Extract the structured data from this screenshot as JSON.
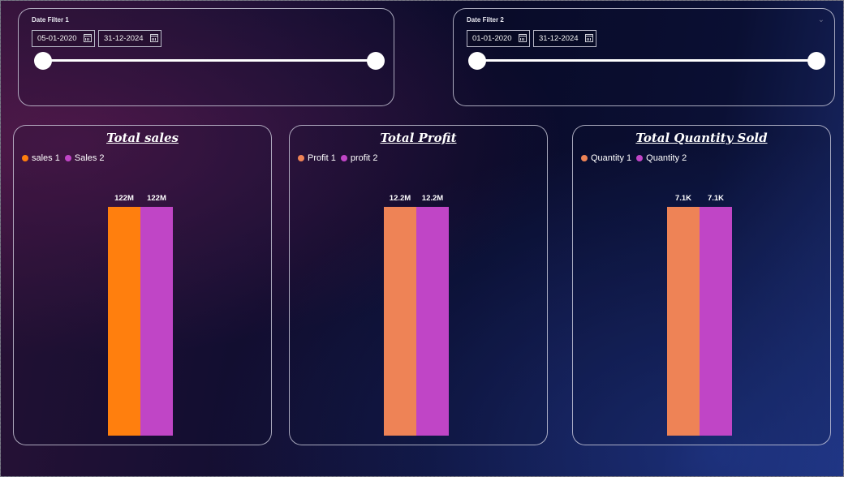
{
  "filters": [
    {
      "title": "Date Filter 1",
      "start": "05-01-2020",
      "end": "31-12-2024"
    },
    {
      "title": "Date Filter 2",
      "start": "01-01-2020",
      "end": "31-12-2024"
    }
  ],
  "chart_data": [
    {
      "type": "bar",
      "title": "Total sales",
      "categories": [
        "sales 1",
        "Sales 2"
      ],
      "series": [
        {
          "name": "sales 1",
          "values": [
            122000000
          ],
          "label": "122M",
          "color": "#FF7F0E"
        },
        {
          "name": "Sales 2",
          "values": [
            122000000
          ],
          "label": "122M",
          "color": "#C045C6"
        }
      ],
      "ylim": [
        0,
        122000000
      ]
    },
    {
      "type": "bar",
      "title": "Total Profit",
      "categories": [
        "Profit 1",
        "profit 2"
      ],
      "series": [
        {
          "name": "Profit 1",
          "values": [
            12200000
          ],
          "label": "12.2M",
          "color": "#EE8356"
        },
        {
          "name": "profit 2",
          "values": [
            12200000
          ],
          "label": "12.2M",
          "color": "#C045C6"
        }
      ],
      "ylim": [
        0,
        12200000
      ]
    },
    {
      "type": "bar",
      "title": "Total Quantity Sold",
      "categories": [
        "Quantity 1",
        "Quantity 2"
      ],
      "series": [
        {
          "name": "Quantity 1",
          "values": [
            7100
          ],
          "label": "7.1K",
          "color": "#EE8356"
        },
        {
          "name": "Quantity 2",
          "values": [
            7100
          ],
          "label": "7.1K",
          "color": "#C045C6"
        }
      ],
      "ylim": [
        0,
        7100
      ]
    }
  ]
}
